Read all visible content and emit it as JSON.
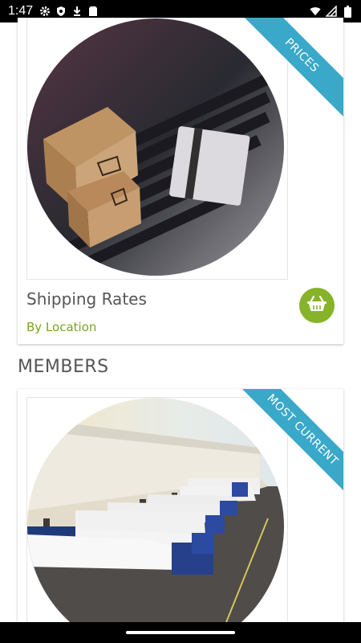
{
  "status_bar": {
    "time": "1:47",
    "left_icons": [
      "gear-icon",
      "shield-icon",
      "download-icon",
      "sdcard-icon"
    ],
    "right_icons": [
      "wifi-icon",
      "signal-icon",
      "battery-icon"
    ]
  },
  "cards": [
    {
      "ribbon": "PRICES",
      "title": "Shipping Rates",
      "subtitle": "By Location",
      "action_icon": "basket-icon"
    },
    {
      "ribbon": "MOST CURRENT"
    }
  ],
  "sections": {
    "members_title": "MEMBERS"
  },
  "colors": {
    "ribbon": "#3aa8c9",
    "accent_green": "#7aa51e",
    "button_green": "#86b32a"
  }
}
